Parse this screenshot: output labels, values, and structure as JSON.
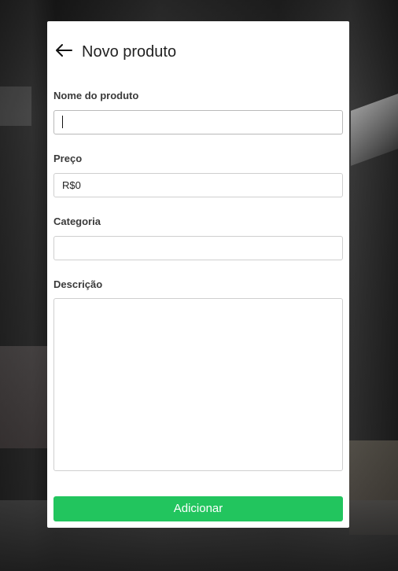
{
  "header": {
    "title": "Novo produto",
    "back_icon": "arrow-left-icon"
  },
  "form": {
    "name": {
      "label": "Nome do produto",
      "value": "",
      "placeholder": ""
    },
    "price": {
      "label": "Preço",
      "value": "R$0",
      "placeholder": ""
    },
    "category": {
      "label": "Categoria",
      "value": "",
      "placeholder": ""
    },
    "description": {
      "label": "Descrição",
      "value": "",
      "placeholder": ""
    },
    "submit_label": "Adicionar"
  },
  "colors": {
    "accent": "#22c55e",
    "card_background": "#ffffff",
    "label_text": "#3a3a3a"
  }
}
